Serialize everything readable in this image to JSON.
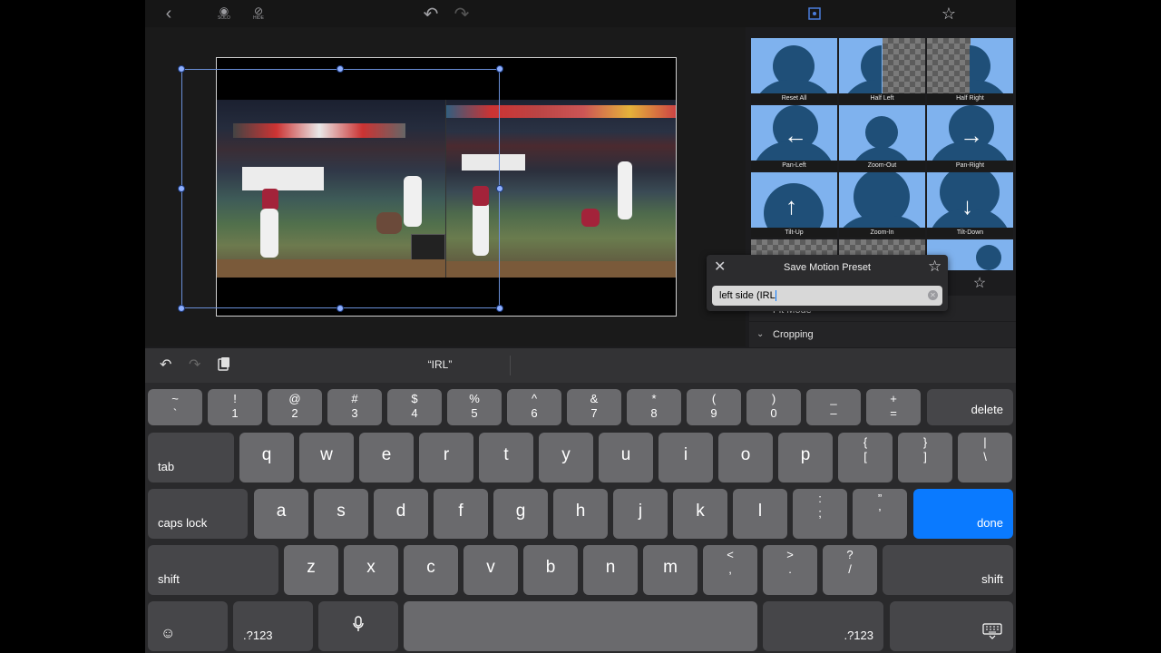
{
  "top_bar": {
    "back": "‹",
    "solo_label": "SOLO",
    "hide_label": "HIDE",
    "undo": "↶",
    "redo": "↷",
    "star": "☆"
  },
  "preset_panel": {
    "tiles": [
      {
        "label": "Reset All"
      },
      {
        "label": "Half Left"
      },
      {
        "label": "Half Right"
      },
      {
        "label": "Pan-Left"
      },
      {
        "label": "Zoom-Out"
      },
      {
        "label": "Pan-Right"
      },
      {
        "label": "Tilt-Up"
      },
      {
        "label": "Zoom-In"
      },
      {
        "label": "Tilt-Down"
      }
    ],
    "rows": {
      "fit_mode_fragment": "Fit Mode",
      "cropping": "Cropping"
    }
  },
  "save_preset": {
    "title": "Save Motion Preset",
    "value": "left side (IRL"
  },
  "keyboard": {
    "suggestion": "“IRL”",
    "row1": [
      {
        "top": "~",
        "bottom": "`"
      },
      {
        "top": "!",
        "bottom": "1"
      },
      {
        "top": "@",
        "bottom": "2"
      },
      {
        "top": "#",
        "bottom": "3"
      },
      {
        "top": "$",
        "bottom": "4"
      },
      {
        "top": "%",
        "bottom": "5"
      },
      {
        "top": "^",
        "bottom": "6"
      },
      {
        "top": "&",
        "bottom": "7"
      },
      {
        "top": "*",
        "bottom": "8"
      },
      {
        "top": "(",
        "bottom": "9"
      },
      {
        "top": ")",
        "bottom": "0"
      },
      {
        "top": "_",
        "bottom": "–"
      },
      {
        "top": "+",
        "bottom": "="
      }
    ],
    "delete": "delete",
    "tab": "tab",
    "row2": [
      "q",
      "w",
      "e",
      "r",
      "t",
      "y",
      "u",
      "i",
      "o",
      "p"
    ],
    "row2_extra": [
      {
        "top": "{",
        "bottom": "["
      },
      {
        "top": "}",
        "bottom": "]"
      },
      {
        "top": "|",
        "bottom": "\\"
      }
    ],
    "caps_lock": "caps lock",
    "row3": [
      "a",
      "s",
      "d",
      "f",
      "g",
      "h",
      "j",
      "k",
      "l"
    ],
    "row3_extra": [
      {
        "top": ":",
        "bottom": ";"
      },
      {
        "top": "”",
        "bottom": "’"
      }
    ],
    "done": "done",
    "shift": "shift",
    "row4": [
      "z",
      "x",
      "c",
      "v",
      "b",
      "n",
      "m"
    ],
    "row4_extra": [
      {
        "top": "<",
        "bottom": ","
      },
      {
        "top": ">",
        "bottom": "."
      },
      {
        "top": "?",
        "bottom": "/"
      }
    ],
    "emoji": "☺",
    "numbers": ".?123",
    "mic": "🎙"
  }
}
